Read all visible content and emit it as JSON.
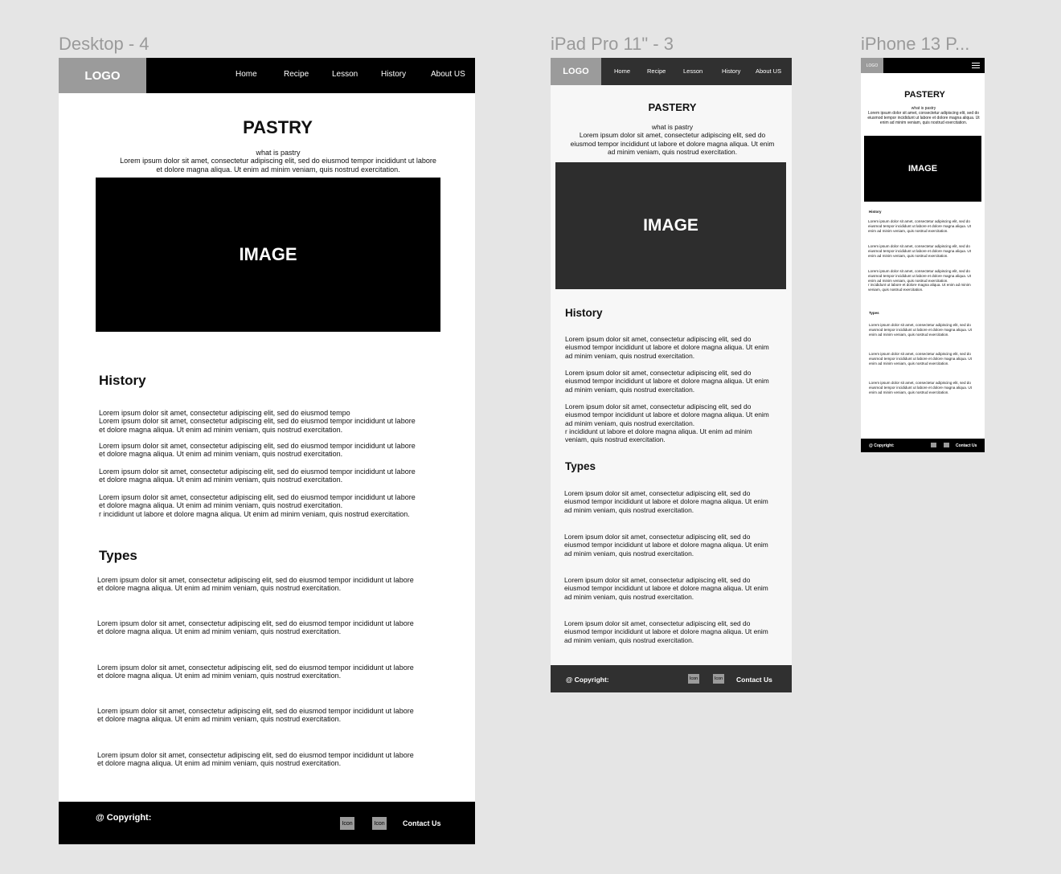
{
  "frames": {
    "desktop": "Desktop - 4",
    "ipad": "iPad Pro 11\" - 3",
    "iphone": "iPhone 13 P..."
  },
  "site": {
    "logo": "LOGO",
    "logo_small": "LOGO",
    "nav": [
      "Home",
      "Recipe",
      "Lesson",
      "History",
      "About US"
    ],
    "title_desktop": "PASTRY",
    "title_tablet": "PASTERY",
    "title_phone": "PASTERY",
    "intro_heading": "what is pastry",
    "intro_text": "Lorem ipsum dolor sit amet, consectetur adipiscing elit, sed do eiusmod tempor incididunt ut labore et dolore magna aliqua. Ut enim ad minim veniam, quis nostrud exercitation.",
    "image_label": "IMAGE",
    "history_heading": "History",
    "types_heading": "Types",
    "desktop_history_first": "Lorem ipsum dolor sit amet, consectetur adipiscing elit, sed do eiusmod tempo",
    "para": "Lorem ipsum dolor sit amet, consectetur adipiscing elit, sed do eiusmod tempor incididunt ut labore et dolore magna aliqua. Ut enim ad minim veniam, quis nostrud exercitation.",
    "para_extra": "r incididunt ut labore et dolore magna aliqua. Ut enim ad minim veniam, quis nostrud exercitation.",
    "copyright": "@ Copyright:",
    "icon_label": "Icon",
    "contact": "Contact Us"
  }
}
